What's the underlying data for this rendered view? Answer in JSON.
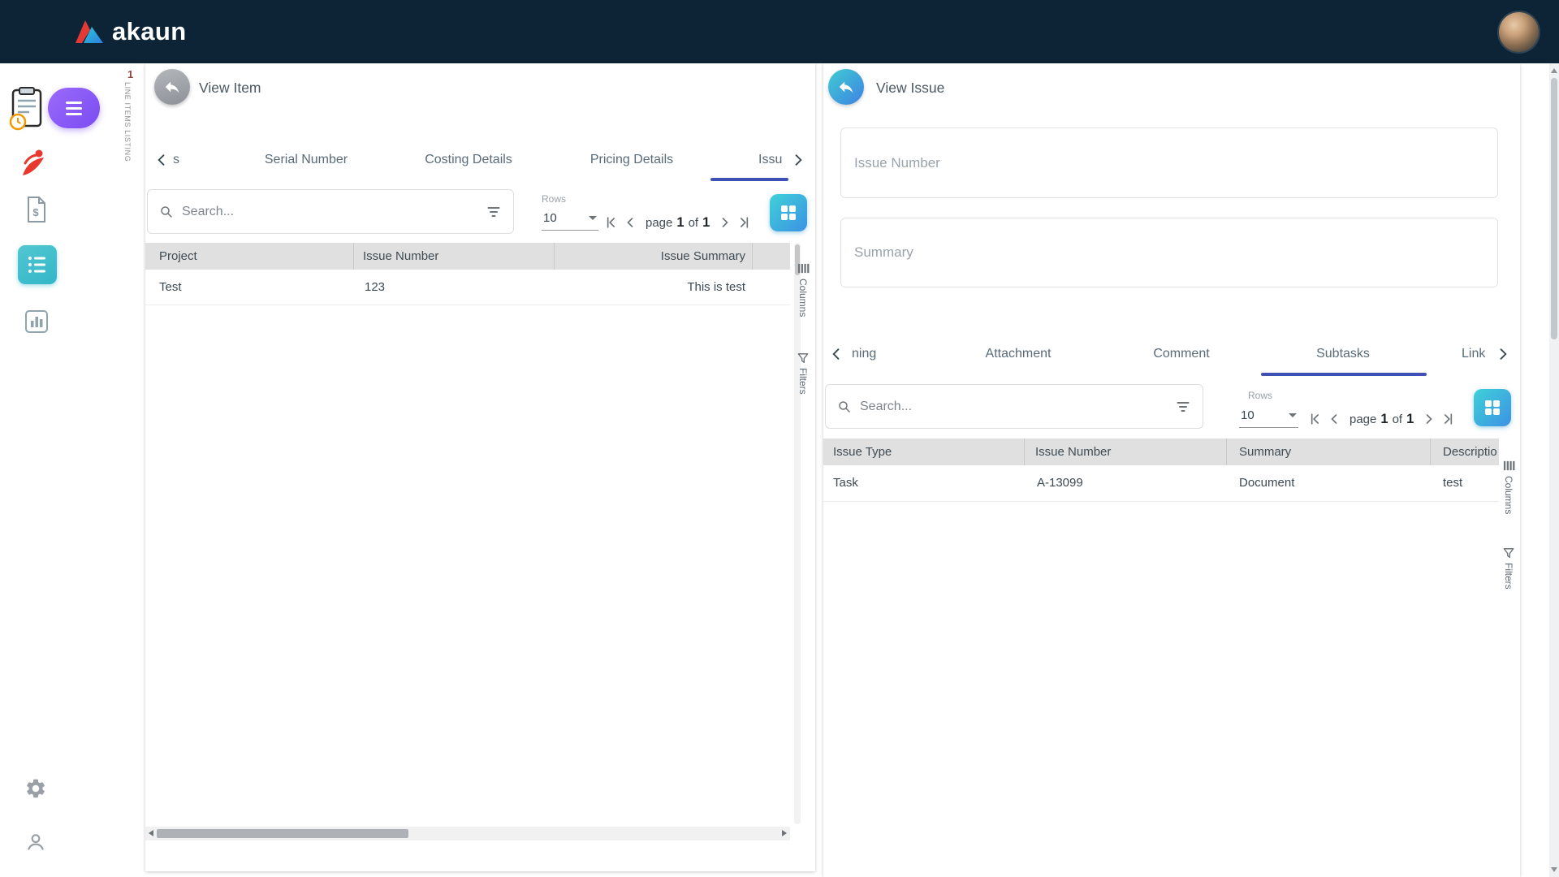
{
  "topbar": {
    "brand": "akaun"
  },
  "sidebar": {
    "badge_number": "1",
    "vertical_label": "LINE ITEMS LISTING"
  },
  "left_panel": {
    "title": "View Item",
    "tabs": {
      "items": [
        "s",
        "Serial Number",
        "Costing Details",
        "Pricing Details",
        "Issu"
      ]
    },
    "search": {
      "placeholder": "Search..."
    },
    "rows": {
      "label": "Rows",
      "value": "10"
    },
    "pagination": {
      "page_label": "page",
      "current": "1",
      "of_label": "of",
      "total": "1"
    },
    "table": {
      "columns": [
        "Project",
        "Issue Number",
        "Issue Summary"
      ],
      "rows": [
        [
          "Test",
          "123",
          "This is test"
        ]
      ]
    },
    "side_labels": {
      "columns": "Columns",
      "filters": "Filters"
    }
  },
  "right_panel": {
    "title": "View Issue",
    "fields": {
      "issue_number": "Issue Number",
      "summary": "Summary"
    },
    "tabs": {
      "items": [
        "ning",
        "Attachment",
        "Comment",
        "Subtasks",
        "Link"
      ]
    },
    "search": {
      "placeholder": "Search..."
    },
    "rows": {
      "label": "Rows",
      "value": "10"
    },
    "pagination": {
      "page_label": "page",
      "current": "1",
      "of_label": "of",
      "total": "1"
    },
    "table": {
      "columns": [
        "Issue Type",
        "Issue Number",
        "Summary",
        "Descriptio"
      ],
      "rows": [
        [
          "Task",
          "A-13099",
          "Document",
          "test"
        ]
      ]
    },
    "side_labels": {
      "columns": "Columns",
      "filters": "Filters"
    }
  },
  "colors": {
    "topbar_bg": "#0d2436",
    "accent_teal": "#40ccd3",
    "accent_blue": "#3d82e2",
    "tab_underline": "#3f51b5",
    "purple_badge": "#7a4bf2",
    "sidebar_active": "#33b6c9",
    "red_icon": "#e8392e",
    "table_header_bg": "#e0e0e0"
  }
}
